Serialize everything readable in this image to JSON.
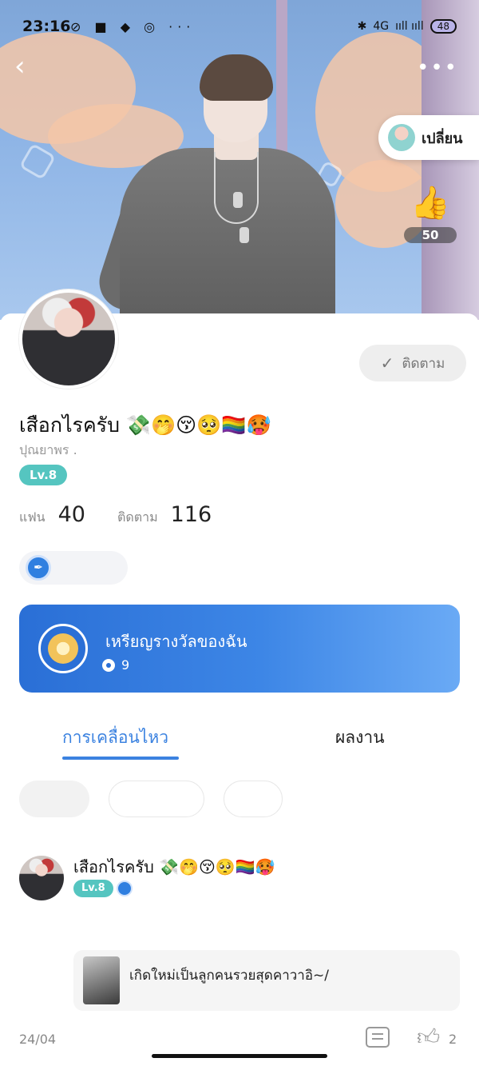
{
  "status_bar": {
    "time": "23:16",
    "left_icons": "⊘ ■ ◆ ◎ ···",
    "network": "4G",
    "signal": "ııll ııll",
    "battery": "48"
  },
  "header": {
    "back_icon": "chevron-left-icon",
    "more_icon": "more-dots-icon",
    "switch_label": "เปลี่ยน",
    "like_count": "50"
  },
  "profile": {
    "follow_label": "ติดตาม",
    "name": "เสือกไรครับ 💸🤭😚🥺🏳️‍🌈🥵",
    "subname": "ปุณยาพร .",
    "level": "Lv.8",
    "stats": [
      {
        "label": "แฟน",
        "value": "40"
      },
      {
        "label": "ติดตาม",
        "value": "116"
      }
    ]
  },
  "medal_card": {
    "title": "เหรียญรางวัลของฉัน",
    "count": "9"
  },
  "tabs": {
    "active": "การเคลื่อนไหว",
    "inactive": "ผลงาน"
  },
  "post": {
    "author": "เสือกไรครับ 💸🤭😚🥺🏳️‍🌈🥵",
    "level": "Lv.8",
    "quote_text": "เกิดใหม่เป็นลูกคนรวยสุดคาวาอิ~/",
    "date": "24/04",
    "like_count": "2"
  },
  "colors": {
    "accent_blue": "#3b82e0",
    "level_teal": "#55c5c0",
    "like_red": "#ff3b4f"
  }
}
